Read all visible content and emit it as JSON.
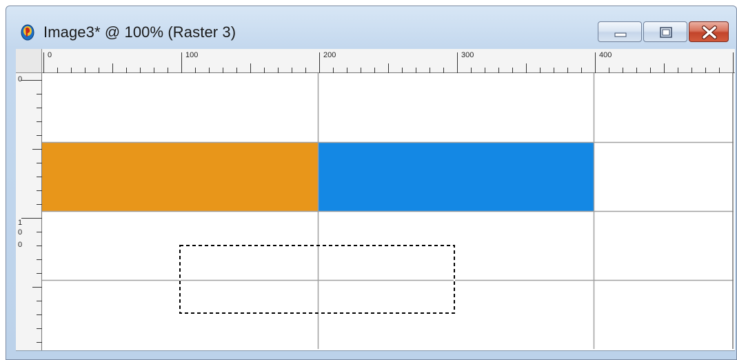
{
  "window": {
    "title": "Image3* @ 100% (Raster 3)",
    "app_icon": "paintshop-pro-icon",
    "controls": {
      "minimize": "minimize-icon",
      "maximize": "maximize-icon",
      "close": "close-icon"
    },
    "colors": {
      "titlebar": "#c4d8ee",
      "close_button": "#c2442a"
    }
  },
  "rulers": {
    "horizontal_labels": [
      "0",
      "100",
      "200",
      "300",
      "400"
    ],
    "vertical_labels": [
      "0",
      "1",
      "0",
      "0"
    ]
  },
  "canvas": {
    "zoom_percent": 100,
    "layer": "Raster 3",
    "fills": {
      "orange": "#e8961a",
      "blue": "#1488e4"
    },
    "grid_color": "#a0a0a0",
    "selection": "dashed-marquee"
  }
}
